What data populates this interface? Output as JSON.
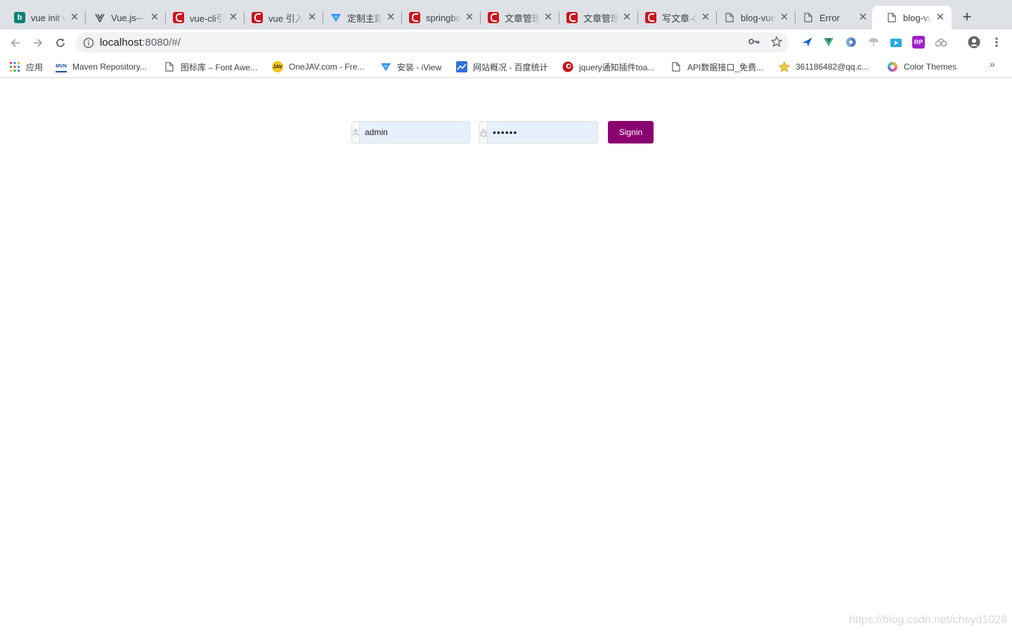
{
  "tabs": [
    {
      "title": "vue init v",
      "icon": "bing-icon"
    },
    {
      "title": "Vue.js—",
      "icon": "vue-js-icon"
    },
    {
      "title": "vue-cli引",
      "icon": "csdn-icon"
    },
    {
      "title": "vue 引入",
      "icon": "csdn-icon"
    },
    {
      "title": "定制主题",
      "icon": "iview-icon"
    },
    {
      "title": "springbo",
      "icon": "csdn-icon"
    },
    {
      "title": "文章管理",
      "icon": "csdn-icon"
    },
    {
      "title": "文章管理",
      "icon": "csdn-icon"
    },
    {
      "title": "写文章-C",
      "icon": "csdn-icon"
    },
    {
      "title": "blog-vue",
      "icon": "document-icon"
    },
    {
      "title": "Error",
      "icon": "document-icon"
    },
    {
      "title": "blog-vue",
      "icon": "document-icon",
      "active": true
    }
  ],
  "toolbar": {
    "url_host": "localhost",
    "url_rest": ":8080/#/"
  },
  "bookmarks": [
    {
      "label": "应用",
      "icon": "apps-grid-icon"
    },
    {
      "label": "Maven Repository...",
      "icon": "maven-icon",
      "icon_text": "MVN"
    },
    {
      "label": "图标库 – Font Awe...",
      "icon": "document-icon"
    },
    {
      "label": "OneJAV.com - Fre...",
      "icon": "jav-icon",
      "icon_text": "JAV"
    },
    {
      "label": "安装 - iView",
      "icon": "iview-icon"
    },
    {
      "label": "网站概况 - 百度统计",
      "icon": "chart-icon"
    },
    {
      "label": "jquery通知插件toa...",
      "icon": "red-circle-icon"
    },
    {
      "label": "API数据接口_免费...",
      "icon": "document-icon"
    },
    {
      "label": "361186482@qq.c...",
      "icon": "star-icon"
    },
    {
      "label": "Color Themes",
      "icon": "color-wheel-icon"
    }
  ],
  "login": {
    "username_value": "admin",
    "password_value": "••••••",
    "signin_label": "Signin"
  },
  "watermark": "https://blog.csdn.net/chsyd1028",
  "colors": {
    "tabstrip": "#dee1e6",
    "signin_button": "#8b006f",
    "autofill": "#e8f0fe"
  }
}
